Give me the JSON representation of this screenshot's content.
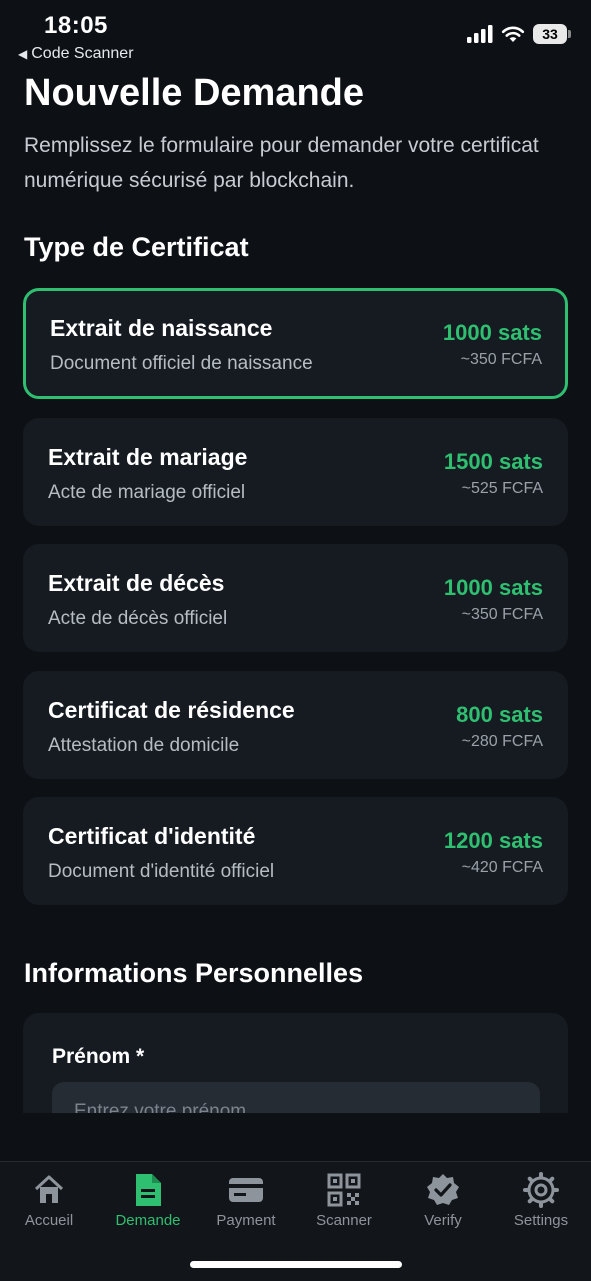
{
  "status_bar": {
    "time": "18:05",
    "back_label": "Code Scanner",
    "battery": "33"
  },
  "header": {
    "title": "Nouvelle Demande",
    "description": "Remplissez le formulaire pour demander votre certificat numérique sécurisé par blockchain."
  },
  "certificate_section": {
    "title": "Type de Certificat",
    "selected_index": 0,
    "items": [
      {
        "name": "Extrait de naissance",
        "subtitle": "Document officiel de naissance",
        "price": "1000 sats",
        "fcfa": "~350 FCFA"
      },
      {
        "name": "Extrait de mariage",
        "subtitle": "Acte de mariage officiel",
        "price": "1500 sats",
        "fcfa": "~525 FCFA"
      },
      {
        "name": "Extrait de décès",
        "subtitle": "Acte de décès officiel",
        "price": "1000 sats",
        "fcfa": "~350 FCFA"
      },
      {
        "name": "Certificat de résidence",
        "subtitle": "Attestation de domicile",
        "price": "800 sats",
        "fcfa": "~280 FCFA"
      },
      {
        "name": "Certificat d'identité",
        "subtitle": "Document d'identité officiel",
        "price": "1200 sats",
        "fcfa": "~420 FCFA"
      }
    ]
  },
  "personal_section": {
    "title": "Informations Personnelles",
    "first_name_label": "Prénom *",
    "first_name_placeholder": "Entrez votre prénom"
  },
  "tab_bar": {
    "active": "Demande",
    "tabs": [
      {
        "label": "Accueil",
        "icon": "home-icon"
      },
      {
        "label": "Demande",
        "icon": "document-icon"
      },
      {
        "label": "Payment",
        "icon": "card-icon"
      },
      {
        "label": "Scanner",
        "icon": "qr-code-icon"
      },
      {
        "label": "Verify",
        "icon": "verified-badge-icon"
      },
      {
        "label": "Settings",
        "icon": "gear-icon"
      }
    ]
  },
  "colors": {
    "accent": "#2fbf71",
    "background": "#0d1116",
    "card": "#161b21"
  }
}
